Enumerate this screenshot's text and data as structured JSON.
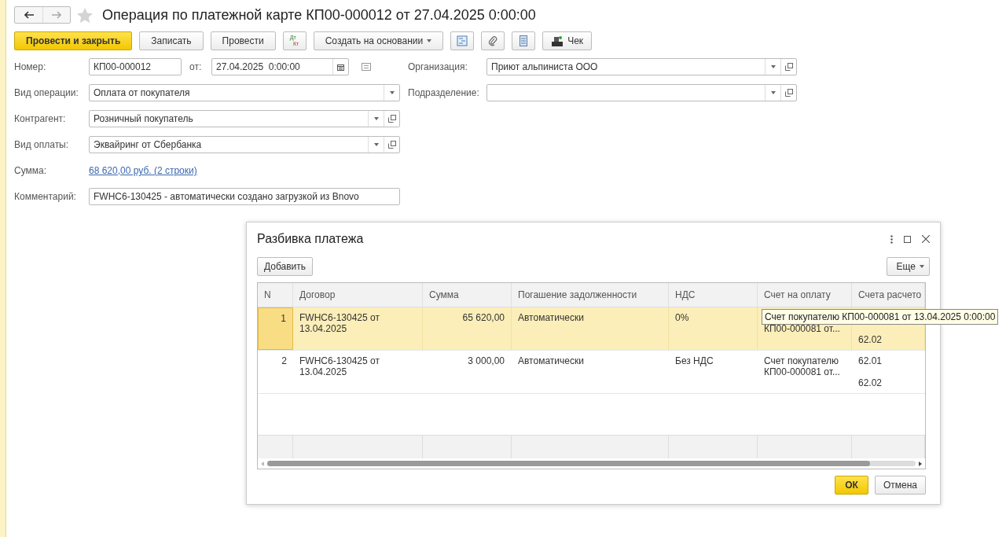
{
  "header": {
    "title": "Операция по платежной карте КП00-000012 от 27.04.2025 0:00:00",
    "favorite": false
  },
  "toolbar": [
    {
      "kind": "primary",
      "label": "Провести и закрыть"
    },
    {
      "kind": "plain",
      "label": "Записать"
    },
    {
      "kind": "plain",
      "label": "Провести"
    },
    {
      "kind": "dtkt",
      "label": "Дт",
      "label2": "Кт"
    },
    {
      "kind": "dropdown",
      "label": "Создать на основании"
    },
    {
      "kind": "structure"
    },
    {
      "kind": "attach"
    },
    {
      "kind": "list"
    },
    {
      "kind": "receipt",
      "label": "Чек"
    }
  ],
  "form": {
    "number": {
      "label": "Номер:",
      "value": "КП00-000012"
    },
    "date": {
      "label": "от:",
      "value": "27.04.2025  0:00:00"
    },
    "organization": {
      "label": "Организация:",
      "value": "Приют альпиниста ООО"
    },
    "operation_type": {
      "label": "Вид операции:",
      "value": "Оплата от покупателя"
    },
    "department": {
      "label": "Подразделение:"
    },
    "counterparty": {
      "label": "Контрагент:",
      "value": "Розничный покупатель"
    },
    "payment_type": {
      "label": "Вид оплаты:",
      "value": "Эквайринг от Сбербанка"
    },
    "sum": {
      "label": "Сумма:",
      "link": "68 620,00 руб. (2 строки)"
    },
    "comment": {
      "label": "Комментарий:",
      "value": "FWHC6-130425 - автоматически создано загрузкой из Bnovo"
    }
  },
  "dialog": {
    "title": "Разбивка платежа",
    "add_button": "Добавить",
    "more_button": "Еще",
    "table": {
      "columns": [
        "N",
        "Договор",
        "Сумма",
        "Погашение задолженности",
        "НДС",
        "Счет на оплату",
        "Счета расчето"
      ],
      "rows": [
        {
          "selected": true,
          "n": "1",
          "contract": [
            "FWHC6-130425 от",
            "13.04.2025"
          ],
          "sum": "65 620,00",
          "repayment": "Автоматически",
          "vat": "0%",
          "invoice": {
            "top_hidden": true,
            "lines": [
              "КП00-000081 от..."
            ]
          },
          "accounts": {
            "top_hidden": true,
            "lines": [
              "62.02"
            ]
          }
        },
        {
          "selected": false,
          "n": "2",
          "contract": [
            "FWHC6-130425 от",
            "13.04.2025"
          ],
          "sum": "3 000,00",
          "repayment": "Автоматически",
          "vat": "Без НДС",
          "invoice": {
            "top_hidden": false,
            "lines": [
              "Счет покупателю",
              "КП00-000081 от..."
            ]
          },
          "accounts": {
            "top_hidden": false,
            "lines": [
              "62.01",
              "62.02"
            ]
          }
        }
      ]
    },
    "tooltip": "Счет покупателю КП00-000081 от 13.04.2025 0:00:00",
    "ok_button": "ОК",
    "cancel_button": "Отмена"
  }
}
